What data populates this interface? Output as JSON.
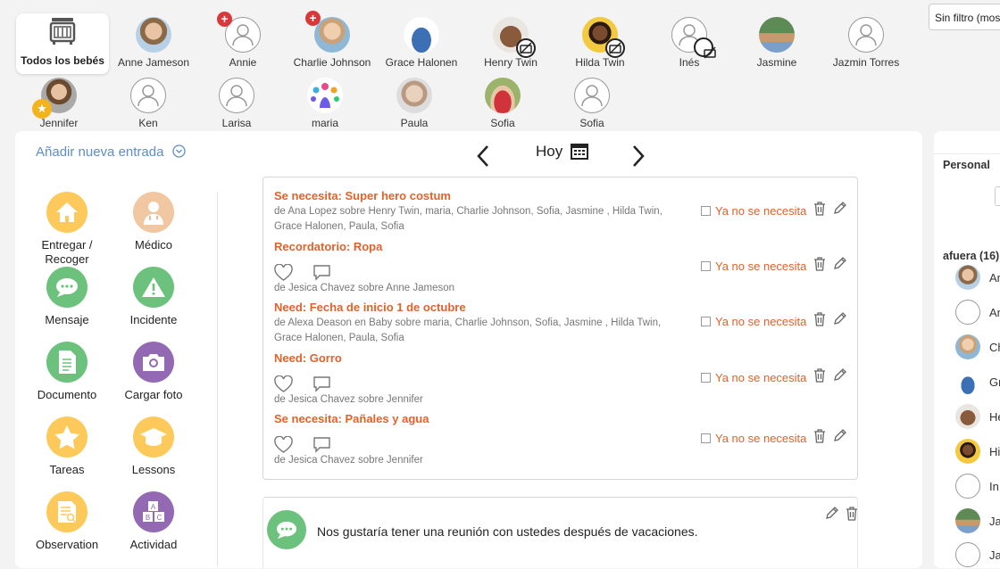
{
  "filter": {
    "label": "Sin filtro (mos"
  },
  "kids": [
    {
      "name": "Todos los bebés"
    },
    {
      "name": "Anne Jameson"
    },
    {
      "name": "Annie"
    },
    {
      "name": "Charlie Johnson"
    },
    {
      "name": "Grace Halonen"
    },
    {
      "name": "Henry Twin"
    },
    {
      "name": "Hilda Twin"
    },
    {
      "name": "Inés"
    },
    {
      "name": "Jasmine"
    },
    {
      "name": "Jazmin Torres"
    },
    {
      "name": "Jennifer"
    },
    {
      "name": "Ken"
    },
    {
      "name": "Larisa"
    },
    {
      "name": "maria"
    },
    {
      "name": "Paula"
    },
    {
      "name": "Sofia"
    },
    {
      "name": "Sofia"
    }
  ],
  "add_entry": "Añadir nueva entrada",
  "date_nav": {
    "label": "Hoy"
  },
  "actions": [
    {
      "label": "Entregar / Recoger",
      "color": "#fcc95a",
      "icon": "house-icon"
    },
    {
      "label": "Médico",
      "color": "#f0c7a0",
      "icon": "doctor-icon"
    },
    {
      "label": "Mensaje",
      "color": "#6cc27d",
      "icon": "chat-bubble-icon"
    },
    {
      "label": "Incidente",
      "color": "#6cc27d",
      "icon": "warning-icon"
    },
    {
      "label": "Documento",
      "color": "#6cc27d",
      "icon": "document-icon"
    },
    {
      "label": "Cargar foto",
      "color": "#9469b3",
      "icon": "camera-icon"
    },
    {
      "label": "Tareas",
      "color": "#fcc95a",
      "icon": "star-icon"
    },
    {
      "label": "Lessons",
      "color": "#fcc95a",
      "icon": "graduation-cap-icon"
    },
    {
      "label": "Observation",
      "color": "#fcc95a",
      "icon": "observation-icon"
    },
    {
      "label": "Actividad",
      "color": "#9469b3",
      "icon": "blocks-icon"
    }
  ],
  "entries": [
    {
      "title": "Se necesita: Super hero costum",
      "sub": "de Ana Lopez sobre Henry Twin, maria, Charlie Johnson, Sofia, Jasmine , Hilda Twin, Grace Halonen, Paula, Sofia"
    },
    {
      "title": "Recordatorio: Ropa",
      "sub": "de Jesica Chavez sobre Anne Jameson"
    },
    {
      "title": "Need: Fecha de inicio 1 de octubre",
      "sub": "de Alexa Deason en Baby sobre maria, Charlie Johnson, Sofia, Jasmine , Hilda Twin, Grace Halonen, Paula, Sofia"
    },
    {
      "title": "Need: Gorro",
      "sub": "de Jesica Chavez sobre Jennifer"
    },
    {
      "title": "Se necesita: Pañales y agua",
      "sub": "de Jesica Chavez sobre Jennifer"
    }
  ],
  "not_needed_label": "Ya no se necesita",
  "message": {
    "text": "Nos gustaría tener una reunión con ustedes después de vacaciones."
  },
  "right_panel": {
    "tab": "Personal",
    "group_label": "afuera (16)",
    "people": [
      "An",
      "An",
      "Ch",
      "Gr",
      "He",
      "Hi",
      "In",
      "Ja",
      "Ja"
    ]
  }
}
